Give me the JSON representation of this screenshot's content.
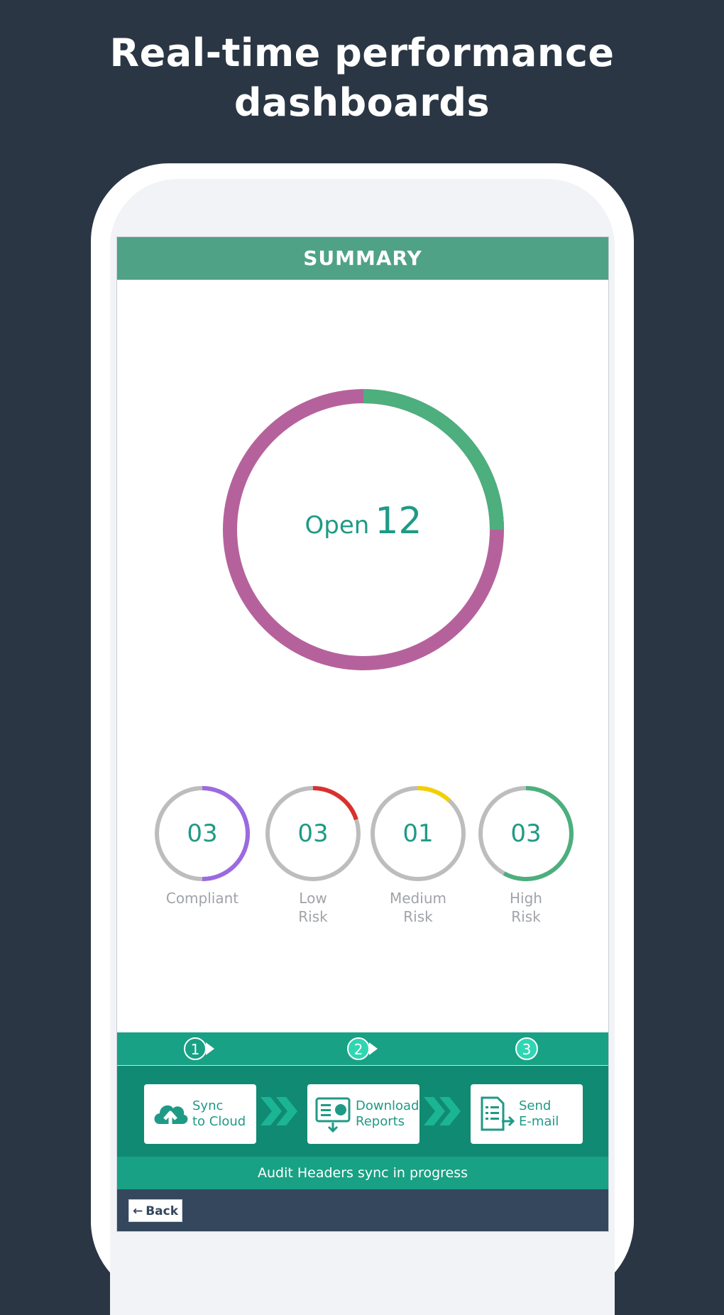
{
  "headline": {
    "line1": "Real-time performance",
    "line2": "dashboards"
  },
  "summary": {
    "title": "SUMMARY",
    "open_label": "Open",
    "open_count": "12"
  },
  "chart_data": {
    "type": "pie",
    "title": "",
    "center_label": "Open 12",
    "donut_segments": [
      {
        "name": "green",
        "fraction": 0.25,
        "color": "#4caf7d"
      },
      {
        "name": "magenta",
        "fraction": 0.75,
        "color": "#b5629c"
      }
    ]
  },
  "stats": [
    {
      "value": "03",
      "label": "Compliant",
      "color": "#9b6ae0",
      "fraction": 0.5
    },
    {
      "value": "03",
      "label": "Low\nRisk",
      "color": "#d8322e",
      "fraction": 0.2
    },
    {
      "value": "01",
      "label": "Medium\nRisk",
      "color": "#f2d000",
      "fraction": 0.12
    },
    {
      "value": "03",
      "label": "High\nRisk",
      "color": "#4caf7d",
      "fraction": 0.58
    }
  ],
  "steps": {
    "numbers": [
      "1",
      "2",
      "3"
    ],
    "actions": [
      {
        "label": "Sync\nto Cloud",
        "icon": "cloud-upload-icon"
      },
      {
        "label": "Download\nReports",
        "icon": "report-download-icon"
      },
      {
        "label": "Send\nE-mail",
        "icon": "document-send-icon"
      }
    ]
  },
  "status_text": "Audit Headers sync in progress",
  "back_label": "Back",
  "colors": {
    "background": "#2a3644",
    "summary_bar": "#4fa286",
    "teal": "#18a184",
    "teal_dark": "#118a73",
    "accent_text": "#1f9a86",
    "footer": "#34475d"
  }
}
